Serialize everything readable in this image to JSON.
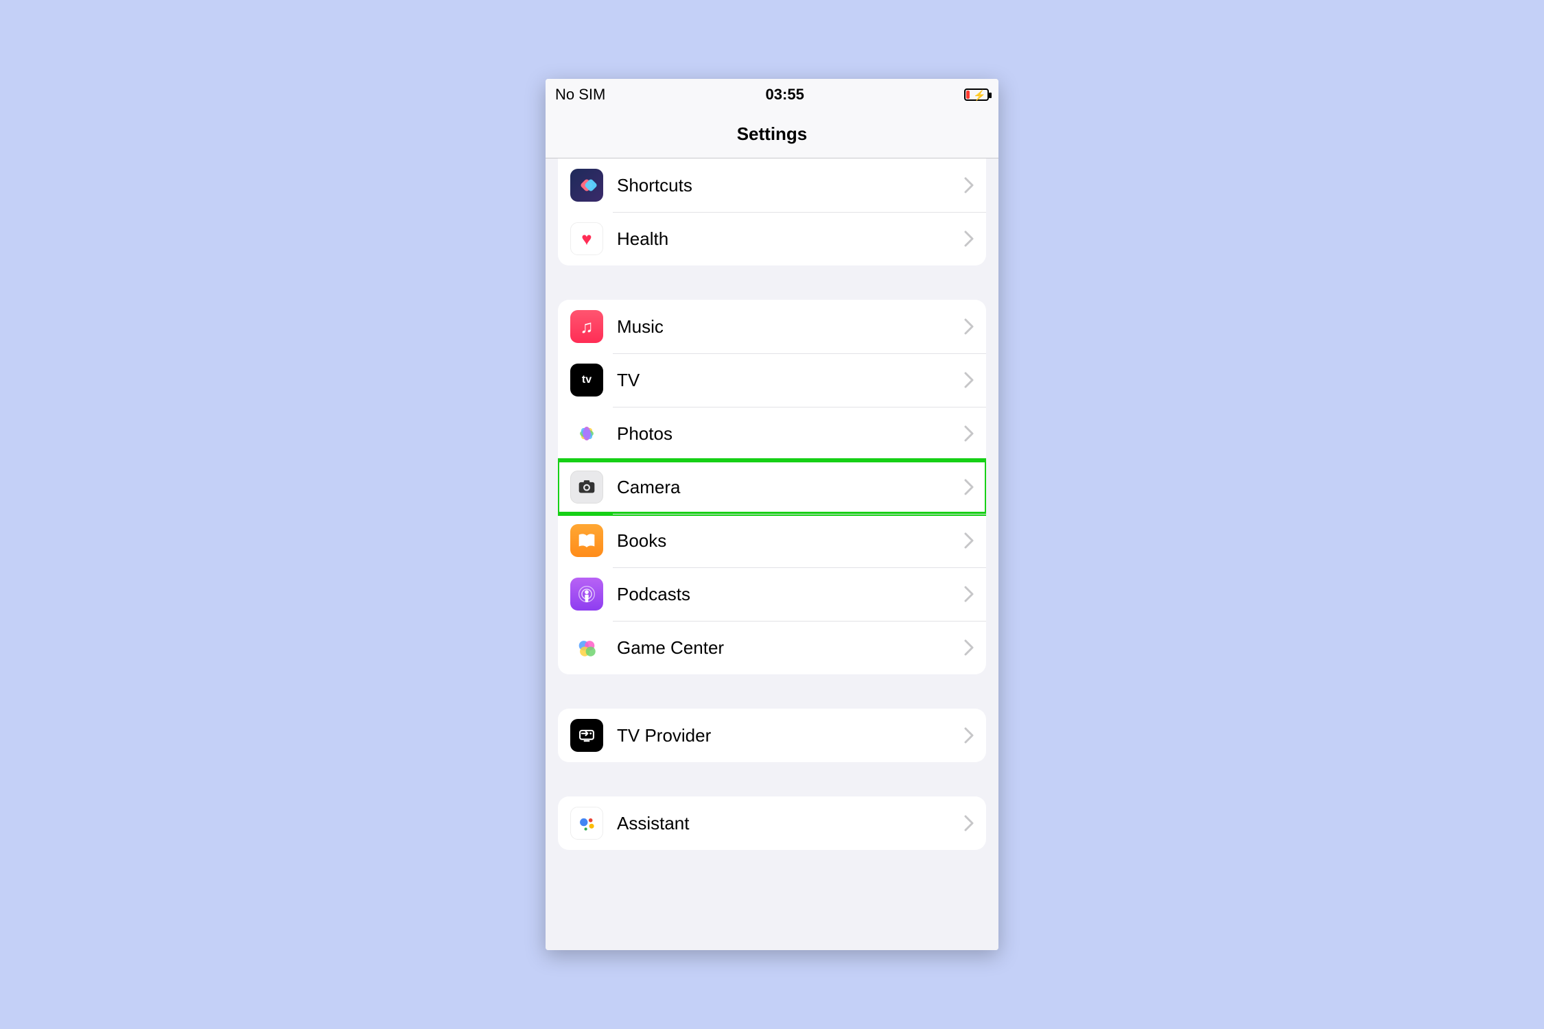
{
  "status": {
    "carrier": "No SIM",
    "time": "03:55"
  },
  "title": "Settings",
  "groups": [
    {
      "items": [
        {
          "key": "shortcuts",
          "label": "Shortcuts"
        },
        {
          "key": "health",
          "label": "Health"
        }
      ]
    },
    {
      "items": [
        {
          "key": "music",
          "label": "Music"
        },
        {
          "key": "tv",
          "label": "TV"
        },
        {
          "key": "photos",
          "label": "Photos"
        },
        {
          "key": "camera",
          "label": "Camera",
          "highlighted": true
        },
        {
          "key": "books",
          "label": "Books"
        },
        {
          "key": "podcasts",
          "label": "Podcasts"
        },
        {
          "key": "gamecenter",
          "label": "Game Center"
        }
      ]
    },
    {
      "items": [
        {
          "key": "tvprovider",
          "label": "TV Provider"
        }
      ]
    },
    {
      "items": [
        {
          "key": "assistant",
          "label": "Assistant"
        }
      ]
    }
  ]
}
